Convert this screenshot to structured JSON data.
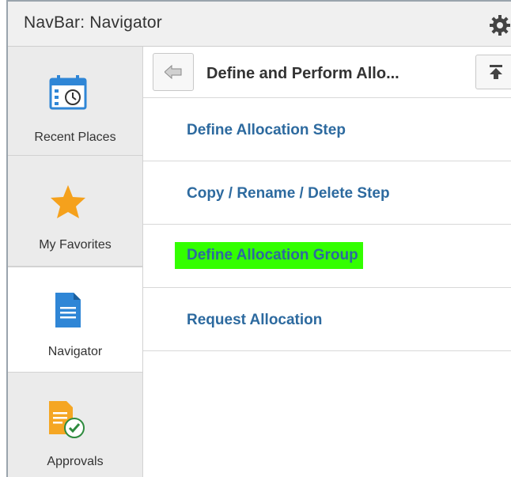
{
  "header": {
    "title": "NavBar: Navigator",
    "settings_icon": "gear-icon"
  },
  "sidebar": {
    "items": [
      {
        "label": "Recent Places",
        "icon": "calendar-clock-icon",
        "active": false
      },
      {
        "label": "My Favorites",
        "icon": "star-icon",
        "active": false
      },
      {
        "label": "Navigator",
        "icon": "document-icon",
        "active": true
      },
      {
        "label": "Approvals",
        "icon": "approvals-icon",
        "active": false
      }
    ]
  },
  "content": {
    "back_icon": "arrow-left-icon",
    "title": "Define and Perform Allo...",
    "top_icon": "scroll-to-top-icon",
    "items": [
      {
        "label": "Define Allocation Step",
        "highlighted": false
      },
      {
        "label": "Copy / Rename / Delete Step",
        "highlighted": false
      },
      {
        "label": "Define Allocation Group",
        "highlighted": true
      },
      {
        "label": "Request Allocation",
        "highlighted": false
      }
    ]
  },
  "colors": {
    "link": "#2d6a9f",
    "highlight": "#33ff00",
    "star": "#f5a11c",
    "doc": "#2f86d6",
    "approvals": "#f5a623"
  }
}
